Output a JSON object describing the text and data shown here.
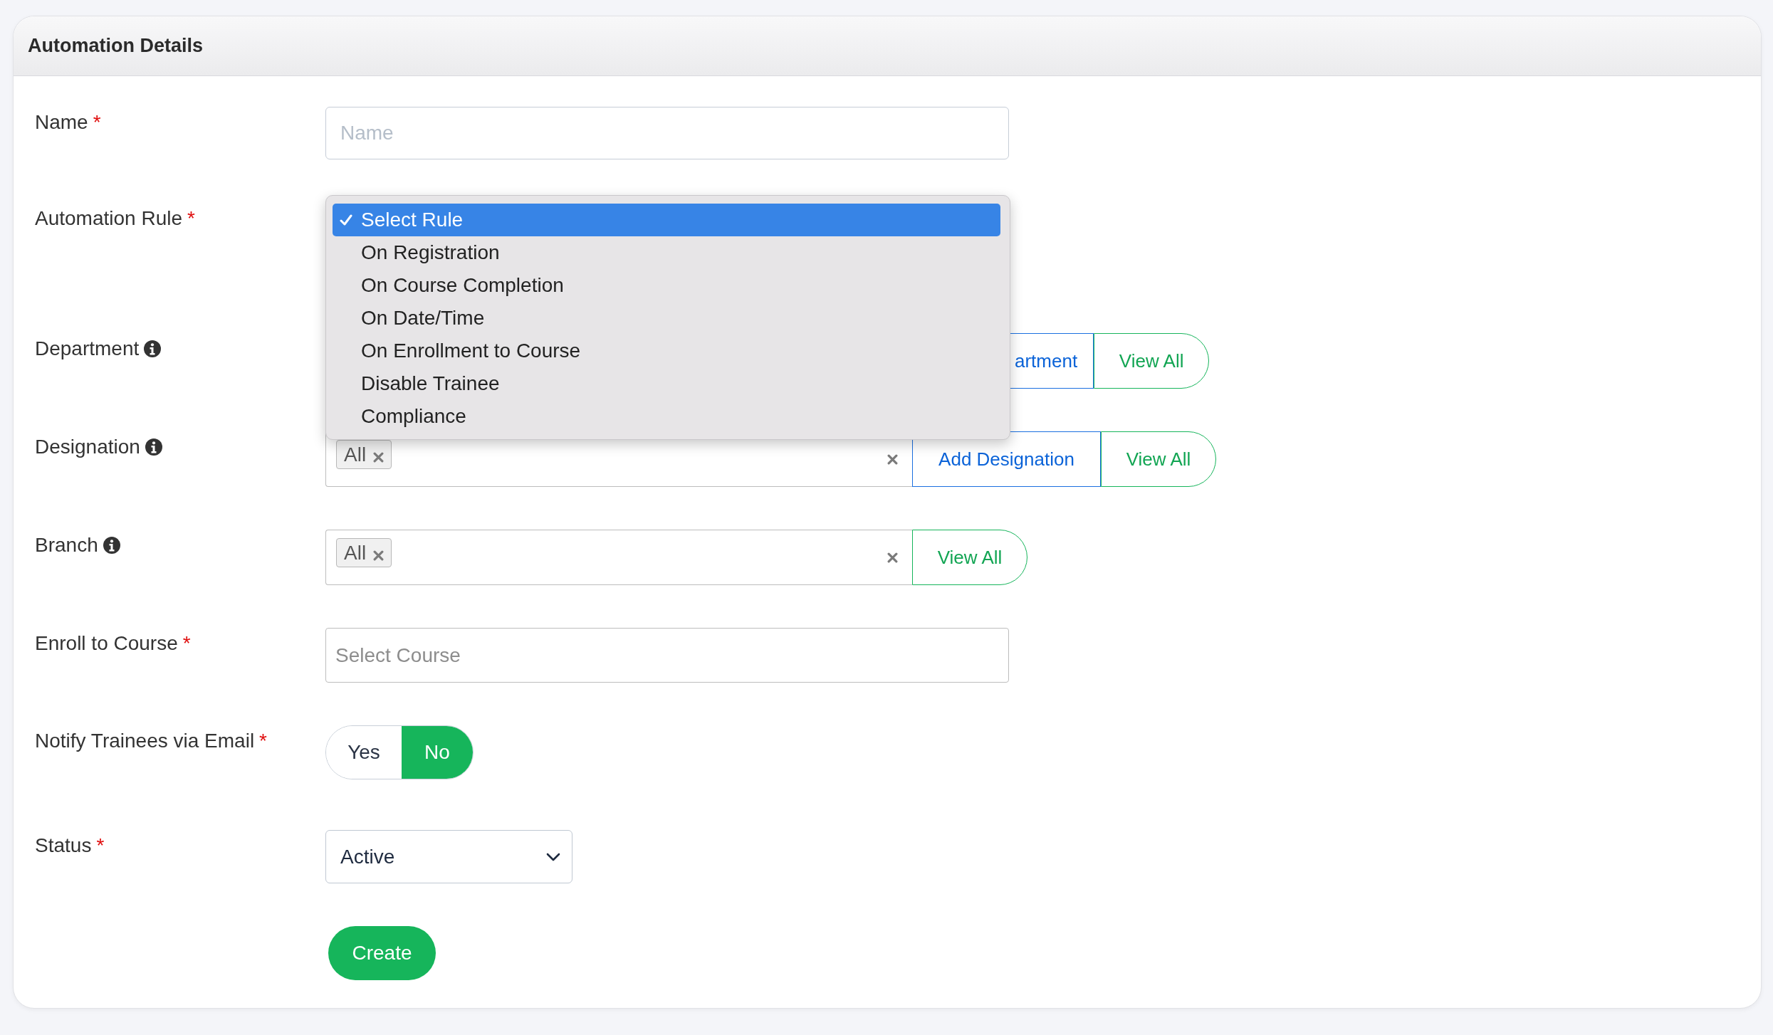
{
  "card": {
    "title": "Automation Details"
  },
  "fields": [
    {
      "kind": "text",
      "label": "Name",
      "required_mark": "*",
      "info": false,
      "placeholder": "Name"
    },
    {
      "kind": "open-select",
      "label": "Automation Rule",
      "required_mark": "*",
      "info": false,
      "options": [
        {
          "label": "Select Rule",
          "selected": true
        },
        {
          "label": "On Registration",
          "selected": false
        },
        {
          "label": "On Course Completion",
          "selected": false
        },
        {
          "label": "On Date/Time",
          "selected": false
        },
        {
          "label": "On Enrollment to Course",
          "selected": false
        },
        {
          "label": "Disable Trainee",
          "selected": false
        },
        {
          "label": "Compliance",
          "selected": false
        }
      ]
    },
    {
      "kind": "multiselect",
      "label": "Department",
      "info": true,
      "buttons": [
        {
          "kind": "add",
          "label": "artment"
        },
        {
          "kind": "view",
          "label": "View All"
        }
      ]
    },
    {
      "kind": "multiselect",
      "label": "Designation",
      "info": true,
      "tags": [
        {
          "label": "All"
        }
      ],
      "buttons": [
        {
          "kind": "add",
          "label": "Add Designation"
        },
        {
          "kind": "view",
          "label": "View All"
        }
      ]
    },
    {
      "kind": "multiselect",
      "label": "Branch",
      "info": true,
      "tags": [
        {
          "label": "All"
        }
      ],
      "buttons": [
        {
          "kind": "view",
          "label": "View All"
        }
      ]
    },
    {
      "kind": "search-select",
      "label": "Enroll to Course",
      "required_mark": "*",
      "info": false,
      "placeholder": "Select Course"
    },
    {
      "kind": "toggle",
      "label": "Notify Trainees via Email",
      "required_mark": "*",
      "info": false,
      "options": [
        {
          "label": "Yes",
          "selected": false
        },
        {
          "label": "No",
          "selected": true
        }
      ]
    },
    {
      "kind": "select",
      "label": "Status",
      "required_mark": "*",
      "info": false,
      "value": "Active"
    }
  ],
  "submit": {
    "label": "Create"
  }
}
